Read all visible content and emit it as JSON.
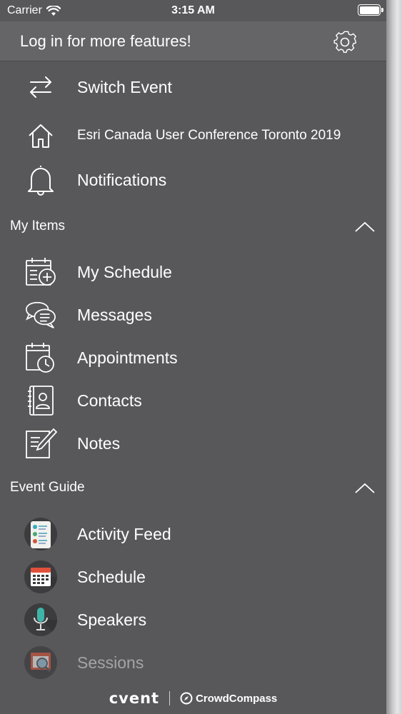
{
  "status_bar": {
    "carrier": "Carrier",
    "time": "3:15 AM"
  },
  "header": {
    "title": "Log in for more features!"
  },
  "top_items": [
    {
      "label": "Switch Event",
      "icon": "swap-arrows-icon"
    },
    {
      "label": "Esri Canada User Conference Toronto 2019",
      "icon": "home-icon"
    },
    {
      "label": "Notifications",
      "icon": "bell-icon"
    }
  ],
  "my_items": {
    "title": "My Items",
    "items": [
      {
        "label": "My Schedule",
        "icon": "calendar-add-icon"
      },
      {
        "label": "Messages",
        "icon": "chat-bubbles-icon"
      },
      {
        "label": "Appointments",
        "icon": "calendar-clock-icon"
      },
      {
        "label": "Contacts",
        "icon": "contact-book-icon"
      },
      {
        "label": "Notes",
        "icon": "note-pencil-icon"
      }
    ]
  },
  "event_guide": {
    "title": "Event Guide",
    "items": [
      {
        "label": "Activity Feed",
        "icon": "activity-feed-icon"
      },
      {
        "label": "Schedule",
        "icon": "schedule-calendar-icon"
      },
      {
        "label": "Speakers",
        "icon": "microphone-icon"
      },
      {
        "label": "Sessions",
        "icon": "sessions-magnifier-icon"
      }
    ]
  },
  "footer": {
    "brand_primary": "cvent",
    "brand_secondary": "CrowdCompass"
  },
  "colors": {
    "background": "#58585a",
    "header": "#656567",
    "text": "#ffffff",
    "faded_text": "#a4a4a6"
  }
}
